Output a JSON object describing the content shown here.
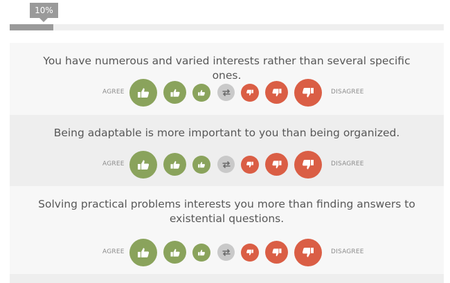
{
  "progress": {
    "percent_label": "10%",
    "fraction": 0.1
  },
  "scale_labels": {
    "agree": "AGREE",
    "disagree": "DISAGREE"
  },
  "icons": {
    "agree": "thumbs-up-icon",
    "neutral": "swap-arrows-icon",
    "disagree": "thumbs-down-icon"
  },
  "colors": {
    "agree": "#8aa35c",
    "neutral": "#c9c9c9",
    "disagree": "#da5e45",
    "progress": "#9a9a9a"
  },
  "questions": [
    {
      "text": "You have numerous and varied interests rather than several specific ones."
    },
    {
      "text": "Being adaptable is more important to you than being organized."
    },
    {
      "text": "Solving practical problems interests you more than finding answers to existential questions."
    }
  ]
}
